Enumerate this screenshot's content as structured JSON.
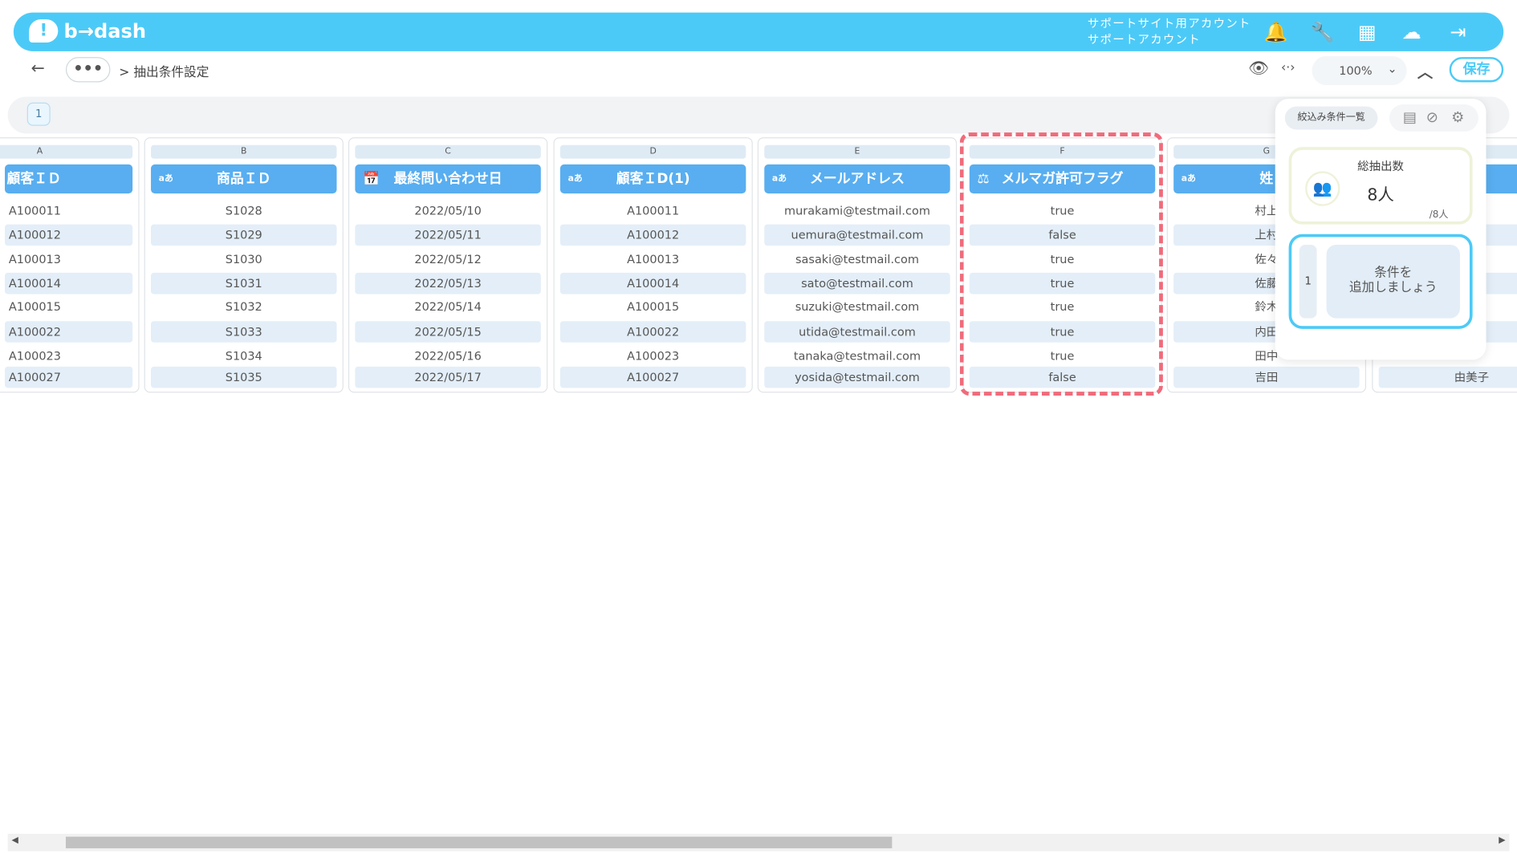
{
  "header": {
    "brand": "b→dash",
    "account_line1": "サポートサイト用アカウント",
    "account_line2": "サポートアカウント",
    "icons": [
      "bell-icon",
      "wrench-icon",
      "grid-icon",
      "support-icon",
      "logout-icon"
    ]
  },
  "nav": {
    "back": "←",
    "more": "•••",
    "breadcrumb": "> 抽出条件設定",
    "zoom": "100%",
    "save_label": "保存"
  },
  "pages": {
    "current": "1"
  },
  "columns": [
    {
      "letter": "A",
      "header": "顧客ＩＤ",
      "type_icon": "",
      "values": [
        "A100011",
        "A100012",
        "A100013",
        "A100014",
        "A100015",
        "A100022",
        "A100023",
        "A100027"
      ]
    },
    {
      "letter": "B",
      "header": "商品ＩＤ",
      "type_icon": "aあ",
      "values": [
        "S1028",
        "S1029",
        "S1030",
        "S1031",
        "S1032",
        "S1033",
        "S1034",
        "S1035"
      ]
    },
    {
      "letter": "C",
      "header": "最終問い合わせ日",
      "type_icon": "📅",
      "values": [
        "2022/05/10",
        "2022/05/11",
        "2022/05/12",
        "2022/05/13",
        "2022/05/14",
        "2022/05/15",
        "2022/05/16",
        "2022/05/17"
      ]
    },
    {
      "letter": "D",
      "header": "顧客ＩD(1)",
      "type_icon": "aあ",
      "values": [
        "A100011",
        "A100012",
        "A100013",
        "A100014",
        "A100015",
        "A100022",
        "A100023",
        "A100027"
      ]
    },
    {
      "letter": "E",
      "header": "メールアドレス",
      "type_icon": "aあ",
      "values": [
        "murakami@testmail.com",
        "uemura@testmail.com",
        "sasaki@testmail.com",
        "sato@testmail.com",
        "suzuki@testmail.com",
        "utida@testmail.com",
        "tanaka@testmail.com",
        "yosida@testmail.com"
      ]
    },
    {
      "letter": "F",
      "header": "メルマガ許可フラグ",
      "type_icon": "⚖",
      "values": [
        "true",
        "false",
        "true",
        "true",
        "true",
        "true",
        "true",
        "false"
      ]
    },
    {
      "letter": "G",
      "header": "姓",
      "type_icon": "aあ",
      "values": [
        "村上",
        "上村",
        "佐々",
        "佐藤",
        "鈴木",
        "内田",
        "田中",
        "吉田"
      ]
    },
    {
      "letter": "",
      "header": "",
      "type_icon": "",
      "values": [
        "",
        "",
        "",
        "",
        "",
        "",
        "",
        "由美子"
      ]
    }
  ],
  "panel": {
    "filter_list": "絞込み条件一覧",
    "total_label": "総抽出数",
    "total_count": "8人",
    "total_sub": "/8人",
    "cond_index": "1",
    "add_line1": "条件を",
    "add_line2": "追加しましょう"
  },
  "colors": {
    "header_bg": "#4ccaf7",
    "column_head": "#58aef0",
    "highlight": "#f06b7b"
  }
}
